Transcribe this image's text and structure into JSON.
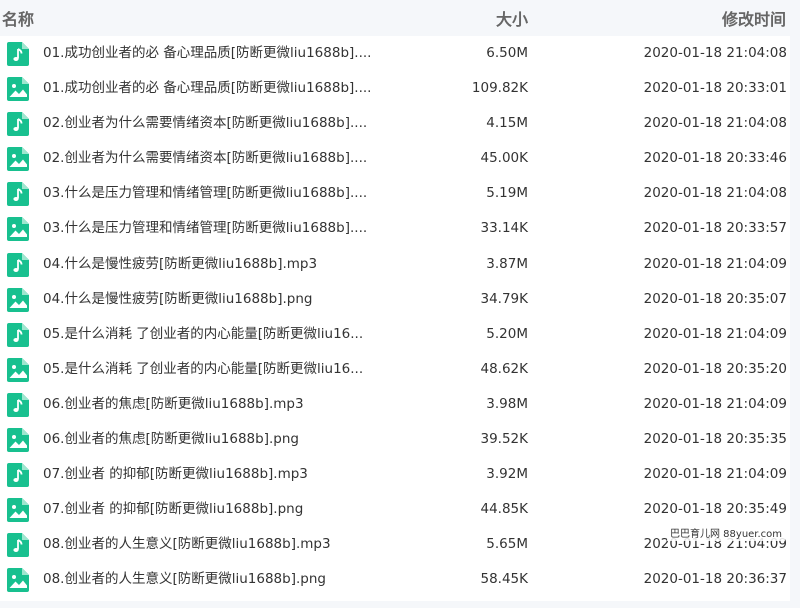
{
  "colors": {
    "icon": "#18c08f",
    "header_bg": "#f5f7fa"
  },
  "header": {
    "name": "名称",
    "size": "大小",
    "modified": "修改时间"
  },
  "files": [
    {
      "name": "01.成功创业者的必 备心理品质[防断更微liu1688b]....",
      "size": "6.50M",
      "modified": "2020-01-18 21:04:08",
      "icon": "audio-file-icon"
    },
    {
      "name": "01.成功创业者的必 备心理品质[防断更微liu1688b]....",
      "size": "109.82K",
      "modified": "2020-01-18 20:33:01",
      "icon": "image-file-icon"
    },
    {
      "name": "02.创业者为什么需要情绪资本[防断更微liu1688b]....",
      "size": "4.15M",
      "modified": "2020-01-18 21:04:08",
      "icon": "audio-file-icon"
    },
    {
      "name": "02.创业者为什么需要情绪资本[防断更微liu1688b]....",
      "size": "45.00K",
      "modified": "2020-01-18 20:33:46",
      "icon": "image-file-icon"
    },
    {
      "name": "03.什么是压力管理和情绪管理[防断更微liu1688b]....",
      "size": "5.19M",
      "modified": "2020-01-18 21:04:08",
      "icon": "audio-file-icon"
    },
    {
      "name": "03.什么是压力管理和情绪管理[防断更微liu1688b]....",
      "size": "33.14K",
      "modified": "2020-01-18 20:33:57",
      "icon": "image-file-icon"
    },
    {
      "name": "04.什么是慢性疲劳[防断更微liu1688b].mp3",
      "size": "3.87M",
      "modified": "2020-01-18 21:04:09",
      "icon": "audio-file-icon"
    },
    {
      "name": "04.什么是慢性疲劳[防断更微liu1688b].png",
      "size": "34.79K",
      "modified": "2020-01-18 20:35:07",
      "icon": "image-file-icon"
    },
    {
      "name": "05.是什么消耗 了创业者的内心能量[防断更微liu16...",
      "size": "5.20M",
      "modified": "2020-01-18 21:04:09",
      "icon": "audio-file-icon"
    },
    {
      "name": "05.是什么消耗 了创业者的内心能量[防断更微liu16...",
      "size": "48.62K",
      "modified": "2020-01-18 20:35:20",
      "icon": "image-file-icon"
    },
    {
      "name": "06.创业者的焦虑[防断更微liu1688b].mp3",
      "size": "3.98M",
      "modified": "2020-01-18 21:04:09",
      "icon": "audio-file-icon"
    },
    {
      "name": "06.创业者的焦虑[防断更微liu1688b].png",
      "size": "39.52K",
      "modified": "2020-01-18 20:35:35",
      "icon": "image-file-icon"
    },
    {
      "name": "07.创业者 的抑郁[防断更微liu1688b].mp3",
      "size": "3.92M",
      "modified": "2020-01-18 21:04:09",
      "icon": "audio-file-icon"
    },
    {
      "name": "07.创业者 的抑郁[防断更微liu1688b].png",
      "size": "44.85K",
      "modified": "2020-01-18 20:35:49",
      "icon": "image-file-icon"
    },
    {
      "name": "08.创业者的人生意义[防断更微liu1688b].mp3",
      "size": "5.65M",
      "modified": "2020-01-18 21:04:09",
      "icon": "audio-file-icon"
    },
    {
      "name": "08.创业者的人生意义[防断更微liu1688b].png",
      "size": "58.45K",
      "modified": "2020-01-18 20:36:37",
      "icon": "image-file-icon"
    }
  ],
  "watermark": "巴巴育儿网 88yuer.com"
}
